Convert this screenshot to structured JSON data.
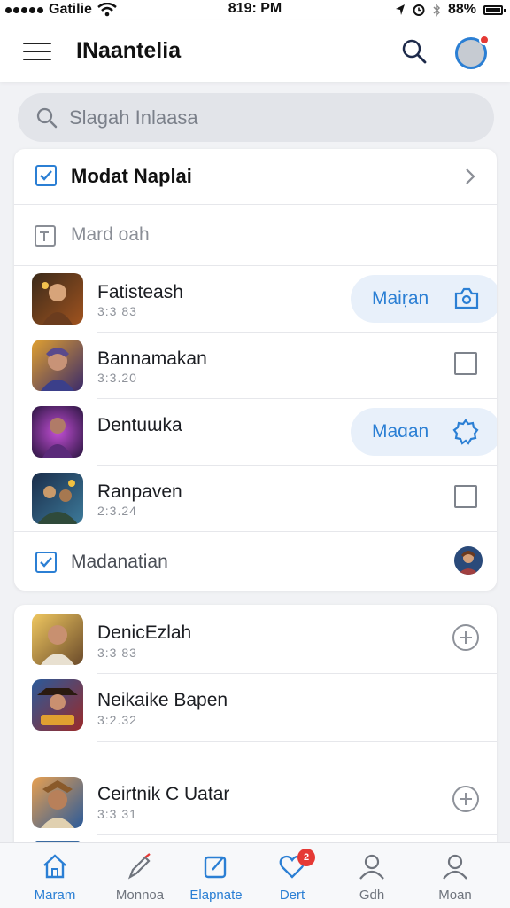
{
  "status_bar": {
    "carrier": "Gatilie",
    "time": "819: PM",
    "battery": "88%",
    "icons": [
      "signal-dots-icon",
      "wifi-icon",
      "location-icon",
      "alarm-icon",
      "bluetooth-icon",
      "battery-icon"
    ]
  },
  "app_bar": {
    "title": "INaantelia",
    "icons": [
      "menu-icon",
      "search-icon",
      "profile-avatar"
    ],
    "accent": "#2b7fd4",
    "notification_color": "#e53935"
  },
  "search": {
    "placeholder": "Slagah Inlaasa"
  },
  "card1": {
    "header": "Modat Naplai",
    "subheader": "Mard oah",
    "rows": [
      {
        "name": "Fatisteash",
        "meta": "3:3 83",
        "action": "pill",
        "action_label": "Maiṛan",
        "action_icon": "camera-icon"
      },
      {
        "name": "Bannamakan",
        "meta": "3:3.20",
        "action": "checkbox"
      },
      {
        "name": "Dentuɯka",
        "meta": "",
        "action": "pill",
        "action_label": "Maɑan",
        "action_icon": "settings-icon"
      },
      {
        "name": "Ranpaven",
        "meta": "2:3.24",
        "action": "checkbox"
      }
    ],
    "footer": "Madanatian"
  },
  "card2": {
    "rows": [
      {
        "name": "DenicEzlah",
        "meta": "3:3 83",
        "action": "plus"
      },
      {
        "name": "Neikaike Bapen",
        "meta": "3:2.32",
        "action": "none"
      },
      {
        "name": "Ceirtnik C Uatar",
        "meta": "3:3 31",
        "action": "plus"
      }
    ]
  },
  "bottom_nav": {
    "items": [
      {
        "label": "Maram",
        "icon": "home-icon",
        "active": true
      },
      {
        "label": "Monnoa",
        "icon": "edit-pencil-icon",
        "active": false
      },
      {
        "label": "Elapnate",
        "icon": "compose-icon",
        "active": true
      },
      {
        "label": "Dert",
        "icon": "heart-icon",
        "active": true,
        "badge": "2"
      },
      {
        "label": "Gdh",
        "icon": "user-icon",
        "active": false
      },
      {
        "label": "Moan",
        "icon": "user-icon",
        "active": false
      }
    ]
  }
}
